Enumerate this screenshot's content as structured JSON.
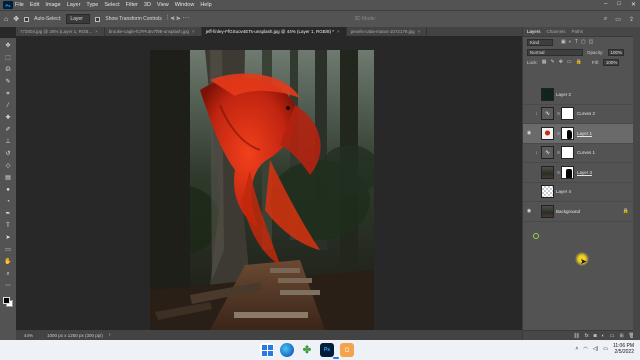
{
  "menubar": {
    "logo": "Ps",
    "items": [
      "File",
      "Edit",
      "Image",
      "Layer",
      "Type",
      "Select",
      "Filter",
      "3D",
      "View",
      "Window",
      "Help"
    ],
    "window_controls": [
      "–",
      "□",
      "✕"
    ]
  },
  "options": {
    "auto_select_label": "Auto-Select:",
    "auto_select_value": "Layer",
    "show_transform_label": "Show Transform Controls",
    "mode_3d_label": "3D Mode:"
  },
  "tabs": [
    {
      "label": "772004.jpg @ 25% (Layer 1, RGB...",
      "active": false
    },
    {
      "label": "brooke-cagle-lCFPu5v7f98-unsplash.jpg",
      "active": false
    },
    {
      "label": "jeff-finley-FfGSuov4ETs-unsplash.jpg @ 44% (Layer 1, RGB/8) *",
      "active": true
    },
    {
      "label": "pexels-catia-matos-1072179.jpg",
      "active": false
    }
  ],
  "tools": [
    "move-icon",
    "marquee-icon",
    "lasso-icon",
    "quick-select-icon",
    "crop-icon",
    "eyedropper-icon",
    "healing-icon",
    "brush-icon",
    "stamp-icon",
    "history-brush-icon",
    "eraser-icon",
    "gradient-icon",
    "blur-icon",
    "dodge-icon",
    "pen-icon",
    "type-icon",
    "path-select-icon",
    "shape-icon",
    "hand-icon",
    "zoom-icon",
    "more-icon"
  ],
  "status": {
    "zoom": "44%",
    "doc_info": "1000 px x 1250 px (300 ppi)"
  },
  "panel": {
    "tabs": [
      "Layers",
      "Channels",
      "Paths"
    ],
    "kind_label": "Kind",
    "blend_mode": "Normal",
    "opacity_label": "Opacity:",
    "opacity_value": "100%",
    "lock_label": "Lock:",
    "fill_label": "Fill:",
    "fill_value": "100%"
  },
  "layers": [
    {
      "name": "Layer 2",
      "visible": false,
      "clip": false,
      "thumb": "dark",
      "mask": null,
      "selected": false
    },
    {
      "name": "Curves 2",
      "visible": false,
      "clip": true,
      "thumb": "adj",
      "mask": "white",
      "selected": false
    },
    {
      "name": "Layer 1",
      "visible": true,
      "clip": false,
      "thumb": "fish",
      "mask": "bw",
      "selected": true
    },
    {
      "name": "Curves 1",
      "visible": false,
      "clip": true,
      "thumb": "adj",
      "mask": "white",
      "selected": false
    },
    {
      "name": "Layer 3",
      "visible": false,
      "clip": false,
      "thumb": "photo",
      "mask": "bw2",
      "selected": false
    },
    {
      "name": "Layer 4",
      "visible": false,
      "clip": false,
      "thumb": "checker",
      "mask": null,
      "selected": false
    },
    {
      "name": "Background",
      "visible": true,
      "clip": false,
      "thumb": "photo",
      "mask": null,
      "selected": false,
      "locked": true
    }
  ],
  "taskbar": {
    "time": "11:06 PM",
    "date": "2/5/2022",
    "ps_label": "Ps"
  }
}
